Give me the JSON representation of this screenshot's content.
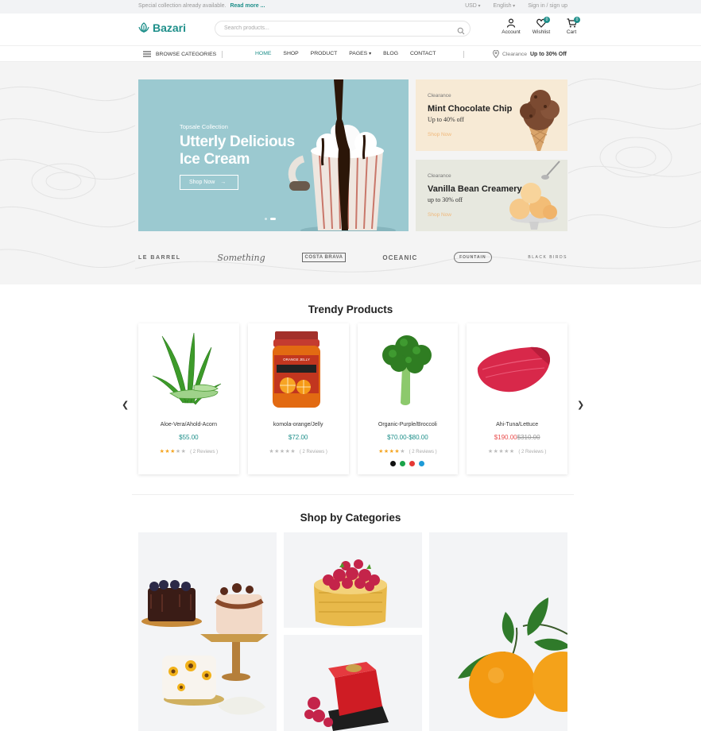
{
  "topbar": {
    "promo_text": "Special collection already available.",
    "promo_link": "Read more ...",
    "currency": "USD",
    "language": "English",
    "auth": "Sign in / sign up"
  },
  "header": {
    "logo": "Bazari",
    "search_placeholder": "Search products...",
    "account_label": "Account",
    "wishlist_label": "Wishlist",
    "wishlist_count": "0",
    "cart_label": "Cart",
    "cart_count": "0"
  },
  "nav": {
    "browse": "BROWSE CATEGORIES",
    "items": [
      {
        "label": "HOME"
      },
      {
        "label": "SHOP"
      },
      {
        "label": "PRODUCT"
      },
      {
        "label": "PAGES"
      },
      {
        "label": "BLOG"
      },
      {
        "label": "CONTACT"
      }
    ],
    "clearance_label": "Clearance",
    "clearance_offer": "Up to 30% Off"
  },
  "hero": {
    "eyebrow": "Topsale Collection",
    "title": "Utterly Delicious Ice Cream",
    "button": "Shop Now"
  },
  "promos": [
    {
      "tag": "Clearance",
      "title": "Mint Chocolate Chip",
      "sub": "Up to 40% off",
      "link": "Shop Now"
    },
    {
      "tag": "Clearance",
      "title": "Vanilla Bean Creamery",
      "sub": "up to 30% off",
      "link": "Shop Now"
    }
  ],
  "brands": [
    "LE BARREL",
    "Something",
    "COSTA BRAVA",
    "OCEANIC",
    "FOUNTAIN",
    "BLACK BIRDS"
  ],
  "trendy": {
    "title": "Trendy Products",
    "products": [
      {
        "name": "Aloe-Vera/Ahold-Acorn",
        "price": "$55.00",
        "old_price": "",
        "stars": "★★★★★",
        "reviews": "( 2 Reviews )"
      },
      {
        "name": "komola-orange/Jelly",
        "price": "$72.00",
        "old_price": "",
        "stars": "★★★★★",
        "reviews": "( 2 Reviews )"
      },
      {
        "name": "Organic-Purple/Broccoli",
        "price": "$70.00-$80.00",
        "old_price": "",
        "stars": "★★★★★",
        "reviews": "( 2 Reviews )"
      },
      {
        "name": "Ahi-Tuna/Lettuce",
        "price": "$190.00",
        "old_price": "$310.00",
        "stars": "★★★★★",
        "reviews": "( 2 Reviews )"
      }
    ],
    "swatch_colors": [
      "#111111",
      "#1aa34a",
      "#e53935",
      "#1e9bd7"
    ]
  },
  "categories": {
    "title": "Shop by Categories"
  },
  "colors": {
    "accent": "#1e8f8a",
    "sale": "#e94d4d",
    "star_on": "#f5a623",
    "star_off": "#bdbdbd"
  }
}
